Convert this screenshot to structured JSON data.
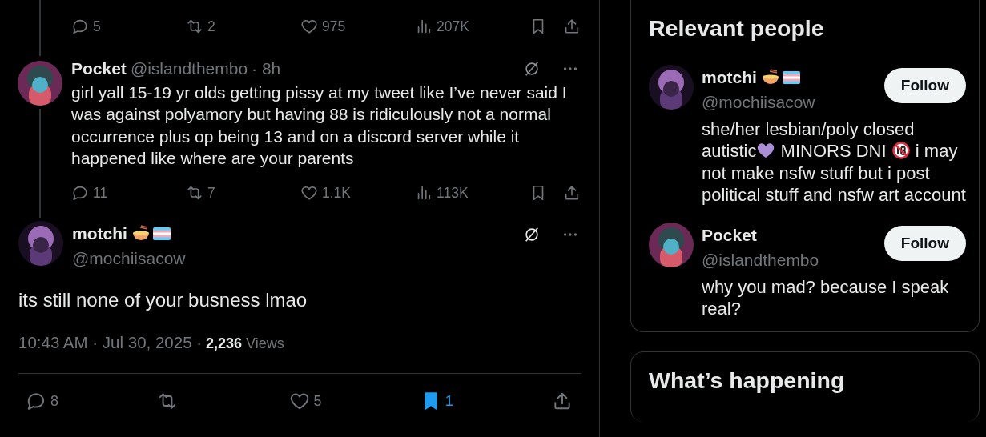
{
  "thread": {
    "previous_actions": [
      {
        "kind": "reply",
        "count": "5"
      },
      {
        "kind": "retweet",
        "count": "2"
      },
      {
        "kind": "like",
        "count": "975"
      },
      {
        "kind": "views",
        "count": "207K"
      },
      {
        "kind": "bookmark",
        "selected": false
      },
      {
        "kind": "share"
      }
    ],
    "reply": {
      "name": "Pocket",
      "handle": "@islandthembo",
      "time": "· 8h",
      "text": "girl yall 15-19 yr olds getting pissy at my tweet like I’ve never said I was against polyamory but having 88 is ridiculously not a normal occurrence plus op being 13 and on a discord server while it happened like where are your parents",
      "actions": [
        {
          "kind": "reply",
          "count": "11"
        },
        {
          "kind": "retweet",
          "count": "7"
        },
        {
          "kind": "like",
          "count": "1.1K"
        },
        {
          "kind": "views",
          "count": "113K"
        },
        {
          "kind": "bookmark",
          "selected": false
        },
        {
          "kind": "share"
        }
      ]
    },
    "main": {
      "name": "motchi",
      "emoji": [
        {
          "kind": "noodles"
        },
        {
          "kind": "flag"
        }
      ],
      "handle": "@mochiisacow",
      "text": "its still none of your busness lmao",
      "timestamp": "10:43 AM · Jul 30, 2025 ·",
      "views": "2,236",
      "views_label": "Views",
      "actions": [
        {
          "kind": "reply",
          "count": "8"
        },
        {
          "kind": "retweet"
        },
        {
          "kind": "like",
          "count": "5"
        },
        {
          "kind": "bookmark",
          "selected": true,
          "count": "1"
        },
        {
          "kind": "share"
        }
      ]
    }
  },
  "relevant_people": {
    "title": "Relevant people",
    "people": [
      {
        "name": "motchi",
        "emoji": [
          {
            "kind": "noodles"
          },
          {
            "kind": "flag"
          }
        ],
        "handle": "@mochiisacow",
        "button": "Follow",
        "bio": [
          {
            "kind": "text",
            "text": "she/her lesbian/poly closed autistic"
          },
          {
            "kind": "heart"
          },
          {
            "kind": "text",
            "text": " MINORS DNI "
          },
          {
            "kind": "no_minors"
          },
          {
            "kind": "text",
            "text": " i may not make nsfw stuff but i post political stuff and nsfw art account"
          }
        ]
      },
      {
        "name": "Pocket",
        "handle": "@islandthembo",
        "button": "Follow",
        "bio": [
          {
            "kind": "text",
            "text": "why you mad? because I speak real?"
          }
        ]
      }
    ]
  },
  "whats_happening": {
    "title": "What’s happening"
  }
}
